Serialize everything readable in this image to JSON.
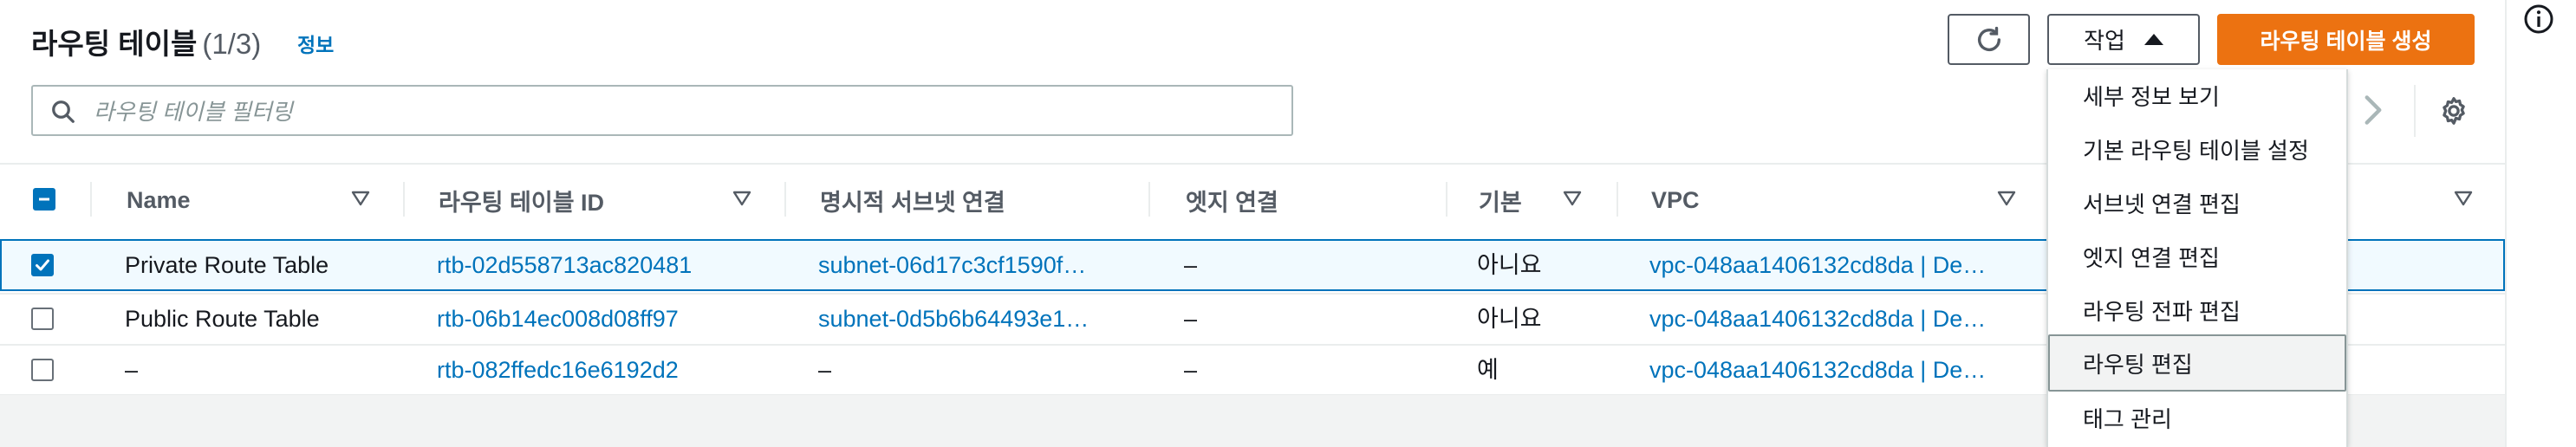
{
  "header": {
    "title": "라우팅 테이블",
    "count": "(1/3)",
    "info_link": "정보",
    "actions_label": "작업",
    "create_label": "라우팅 테이블 생성"
  },
  "search": {
    "placeholder": "라우팅 테이블 필터링",
    "value": ""
  },
  "icons": {
    "refresh": "refresh-icon",
    "caret": "caret-up-icon",
    "search": "search-icon",
    "next": "chevron-right-icon",
    "settings": "gear-icon",
    "info": "info-icon",
    "sort": "sort-down-icon"
  },
  "table": {
    "columns": [
      "Name",
      "라우팅 테이블 ID",
      "명시적 서브넷 연결",
      "엣지 연결",
      "기본",
      "VPC",
      ""
    ],
    "rows": [
      {
        "selected": true,
        "name": "Private Route Table",
        "id": "rtb-02d558713ac820481",
        "subnet": "subnet-06d17c3cf1590f…",
        "edge": "–",
        "main": "아니요",
        "vpc": "vpc-048aa1406132cd8da | De…"
      },
      {
        "selected": false,
        "name": "Public Route Table",
        "id": "rtb-06b14ec008d08ff97",
        "subnet": "subnet-0d5b6b64493e1…",
        "edge": "–",
        "main": "아니요",
        "vpc": "vpc-048aa1406132cd8da | De…"
      },
      {
        "selected": false,
        "name": "–",
        "id": "rtb-082ffedc16e6192d2",
        "subnet": "–",
        "edge": "–",
        "main": "예",
        "vpc": "vpc-048aa1406132cd8da | De…"
      }
    ]
  },
  "actions_menu": {
    "items": [
      "세부 정보 보기",
      "기본 라우팅 테이블 설정",
      "서브넷 연결 편집",
      "엣지 연결 편집",
      "라우팅 전파 편집",
      "라우팅 편집",
      "태그 관리"
    ],
    "hovered_index": 5
  },
  "colors": {
    "accent": "#0073bb",
    "primary_button": "#ec7211",
    "selected_row_bg": "#f1faff",
    "text": "#16191f",
    "muted": "#545b64"
  }
}
